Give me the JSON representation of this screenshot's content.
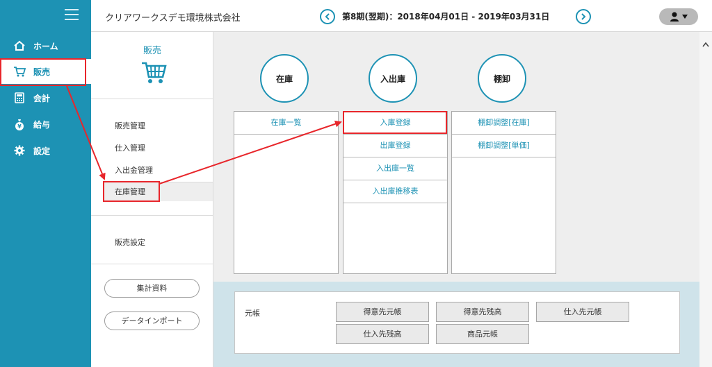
{
  "header": {
    "company": "クリアワークスデモ環境株式会社",
    "period": "第8期(翌期)：2018年04月01日 - 2019年03月31日"
  },
  "nav": {
    "items": [
      {
        "label": "ホーム",
        "icon": "home-icon"
      },
      {
        "label": "販売",
        "icon": "cart-icon"
      },
      {
        "label": "会計",
        "icon": "calculator-icon"
      },
      {
        "label": "給与",
        "icon": "money-bag-icon"
      },
      {
        "label": "設定",
        "icon": "gear-icon"
      }
    ],
    "active": "販売"
  },
  "submenu": {
    "title": "販売",
    "items": [
      "販売管理",
      "仕入管理",
      "入出金管理",
      "在庫管理"
    ],
    "active_item": "在庫管理",
    "settings": "販売設定",
    "buttons": [
      "集計資料",
      "データインポート"
    ]
  },
  "main": {
    "columns": [
      {
        "title": "在庫",
        "items": [
          "在庫一覧"
        ]
      },
      {
        "title": "入出庫",
        "items": [
          "入庫登録",
          "出庫登録",
          "入出庫一覧",
          "入出庫推移表"
        ]
      },
      {
        "title": "棚卸",
        "items": [
          "棚卸調整[在庫]",
          "棚卸調整[単価]"
        ]
      }
    ]
  },
  "ledger": {
    "label": "元帳",
    "buttons": [
      "得意先元帳",
      "得意先残高",
      "仕入先元帳",
      "仕入先残高",
      "商品元帳"
    ]
  },
  "colors": {
    "sidebar": "#1d92b4",
    "accent": "#1d92b4",
    "highlight": "#e8262b",
    "main_bg": "#eeeeee",
    "bottom_bg": "#cfe3ea"
  }
}
